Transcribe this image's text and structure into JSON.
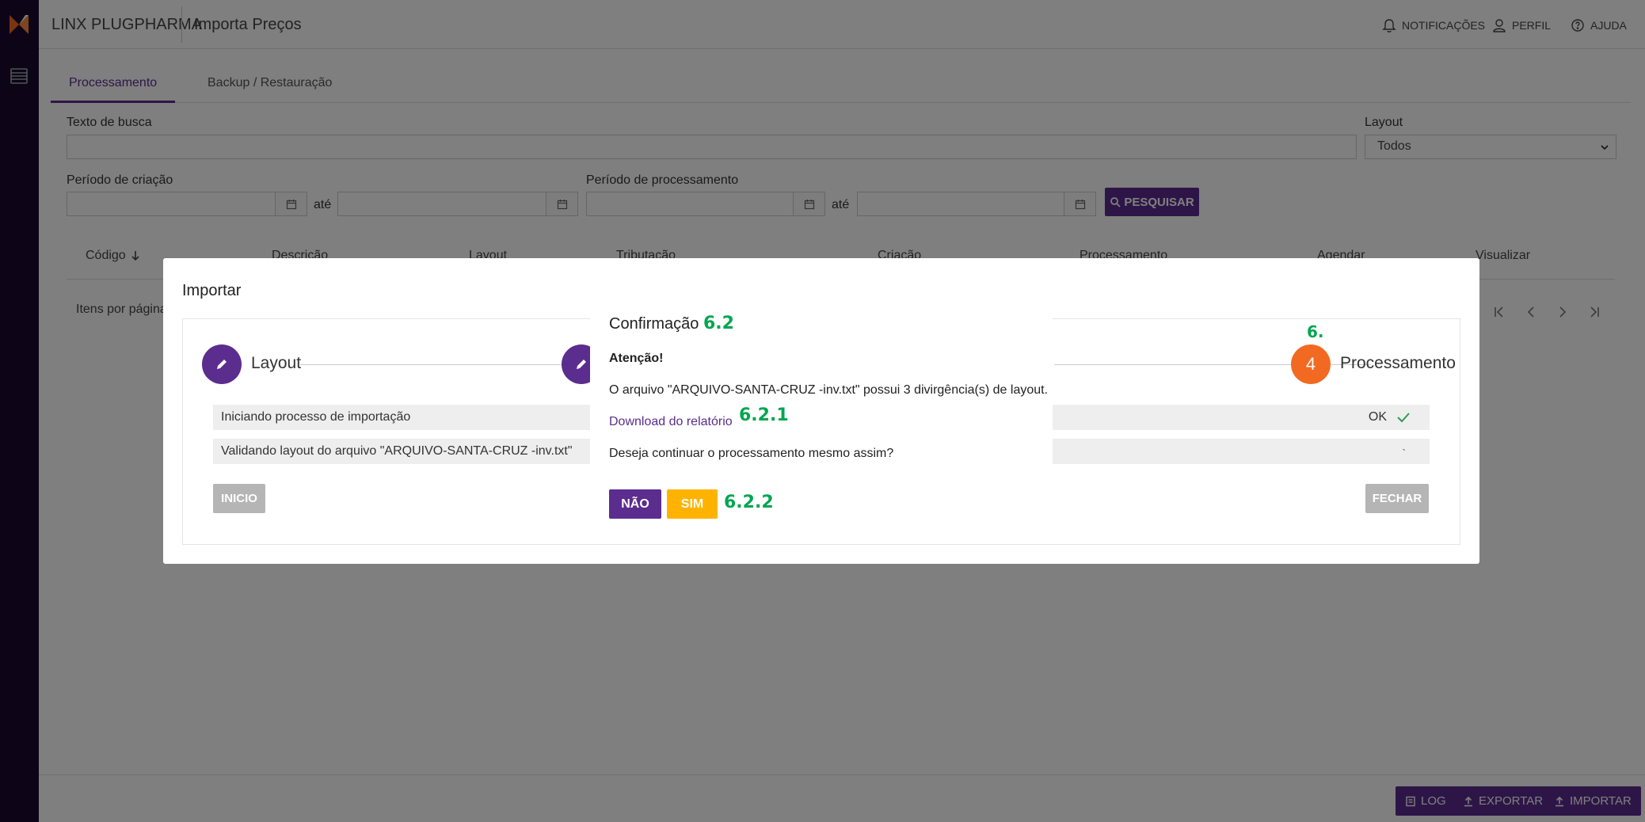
{
  "app": {
    "brand": "LINX PLUGPHARMA",
    "page_title": "Importa Preços"
  },
  "header_nav": {
    "notifications": "NOTIFICAÇÕES",
    "profile": "PERFIL",
    "help": "AJUDA"
  },
  "tabs": [
    {
      "label": "Processamento"
    },
    {
      "label": "Backup / Restauração"
    }
  ],
  "filters": {
    "search_label": "Texto de busca",
    "layout_label": "Layout",
    "layout_value": "Todos",
    "creation_label": "Período de criação",
    "processing_label": "Período de processamento",
    "until": "até",
    "search_button": "PESQUISAR"
  },
  "table": {
    "columns": [
      "Código",
      "Descrição",
      "Layout",
      "Tributação",
      "Criação",
      "Processamento",
      "Agendar",
      "Visualizar"
    ],
    "per_page_label": "Itens por página"
  },
  "footer": {
    "log": "LOG",
    "export": "EXPORTAR",
    "import": "IMPORTAR"
  },
  "import_modal": {
    "title": "Importar",
    "steps": [
      {
        "label": "Layout"
      },
      {
        "number": "4",
        "label": "Processamento"
      }
    ],
    "status_rows": [
      {
        "text": "Iniciando processo de importação",
        "status": "OK"
      },
      {
        "text": "Validando layout do arquivo \"ARQUIVO-SANTA-CRUZ -inv.txt\"",
        "status": "`"
      }
    ],
    "start_button": "INICIO",
    "close_button": "FECHAR",
    "step_annotation": "6."
  },
  "confirm_dialog": {
    "title": "Confirmação",
    "title_annotation": "6.2",
    "attention": "Atenção!",
    "message": "O arquivo \"ARQUIVO-SANTA-CRUZ -inv.txt\" possui 3 divirgência(s) de layout.",
    "report_link": "Download do relatório",
    "link_annotation": "6.2.1",
    "question": "Deseja continuar o processamento mesmo assim?",
    "no_button": "NÃO",
    "yes_button": "SIM",
    "buttons_annotation": "6.2.2"
  },
  "colors": {
    "primary": "#5b2d8e",
    "accent": "#f26a21",
    "yes": "#ffb300",
    "annotation": "#00a650",
    "sidebar": "#1a0a2e"
  }
}
